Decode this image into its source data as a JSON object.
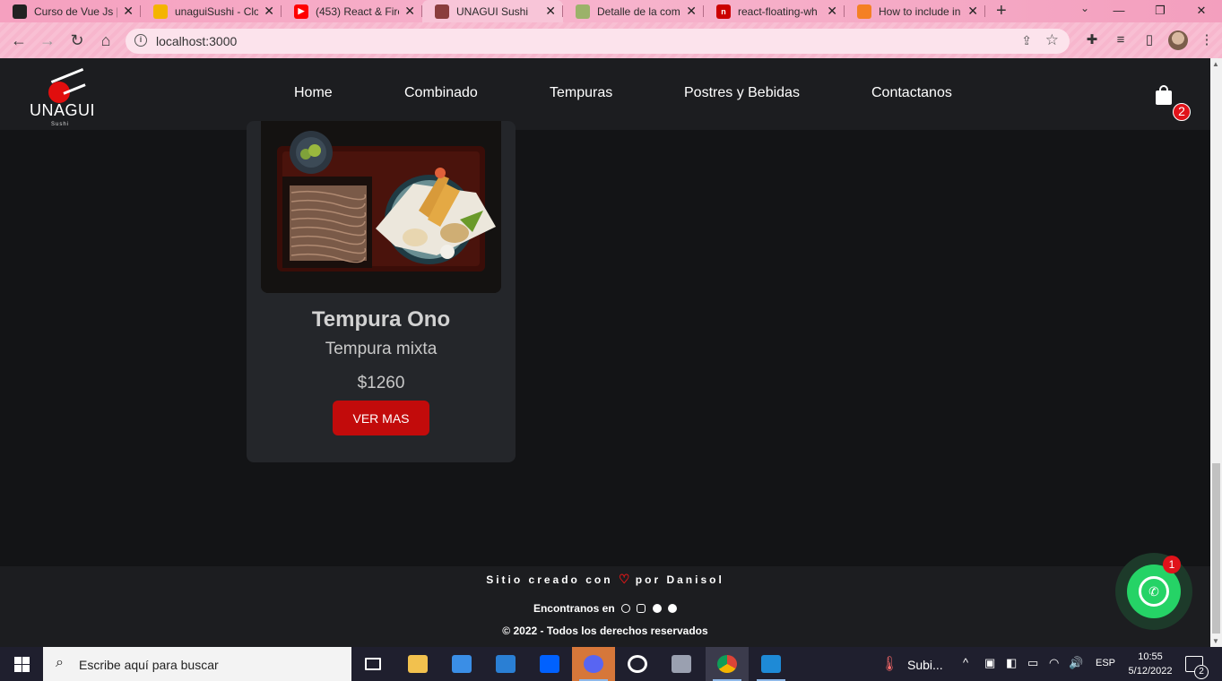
{
  "browser": {
    "tabs": [
      {
        "title": "Curso de Vue Js |",
        "favicon_color": "#222222",
        "favicon_text": "JS"
      },
      {
        "title": "unaguiSushi - Clo",
        "favicon_color": "#f4b400",
        "favicon_text": "▲"
      },
      {
        "title": "(453) React & Fire",
        "favicon_color": "#ff0000",
        "favicon_text": "▶"
      },
      {
        "title": "UNAGUI Sushi",
        "favicon_color": "#8a3d3d",
        "favicon_text": "U",
        "active": true
      },
      {
        "title": "Detalle de la com",
        "favicon_color": "#9bb26a",
        "favicon_text": "◐"
      },
      {
        "title": "react-floating-wh",
        "favicon_color": "#cb0000",
        "favicon_text": "n"
      },
      {
        "title": "How to include in",
        "favicon_color": "#f48024",
        "favicon_text": "S"
      }
    ],
    "new_tab_label": "+",
    "url": "localhost:3000"
  },
  "site": {
    "logo": {
      "name": "UNAGUI",
      "sub": "Sushi"
    },
    "nav": [
      "Home",
      "Combinado",
      "Tempuras",
      "Postres y Bebidas",
      "Contactanos"
    ],
    "cart_count": "2",
    "accent": "#c20b0b"
  },
  "product": {
    "title": "Tempura Ono",
    "subtitle": "Tempura mixta",
    "price": "$1260",
    "button": "VER MAS"
  },
  "footer": {
    "credit_before": "Sitio creado con",
    "credit_after": "por Danisol",
    "find": "Encontranos en",
    "social_icons": [
      "instagram-icon",
      "facebook-icon",
      "twitter-icon",
      "github-icon"
    ],
    "copyright": "© 2022 - Todos los derechos reservados"
  },
  "whatsapp": {
    "badge": "1",
    "color": "#25d366"
  },
  "taskbar": {
    "search_placeholder": "Escribe aquí para buscar",
    "weather_label": "Subi...",
    "language": "ESP",
    "time": "10:55",
    "date": "5/12/2022",
    "notifications": "2"
  }
}
